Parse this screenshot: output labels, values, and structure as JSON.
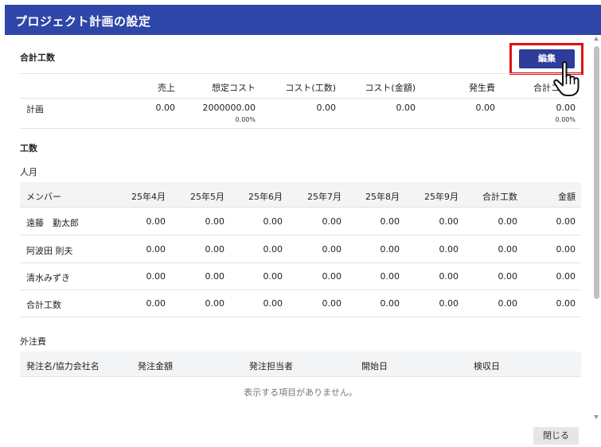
{
  "dialog": {
    "title": "プロジェクト計画の設定"
  },
  "total_effort": {
    "section_title": "合計工数",
    "edit_label": "編集",
    "columns": [
      "売上",
      "想定コスト",
      "コスト(工数)",
      "コスト(金額)",
      "発生費",
      "合計コ"
    ],
    "row_label": "計画",
    "values": [
      "0.00",
      "2000000.00",
      "0.00",
      "0.00",
      "0.00",
      "0.00"
    ],
    "sub_values": [
      "0.00%",
      "0.00%"
    ]
  },
  "effort": {
    "section_title": "工数",
    "person_month": {
      "title": "人月",
      "columns": [
        "メンバー",
        "25年4月",
        "25年5月",
        "25年6月",
        "25年7月",
        "25年8月",
        "25年9月",
        "合計工数",
        "金額"
      ],
      "rows": [
        {
          "member": "遠藤　勤太郎",
          "values": [
            "0.00",
            "0.00",
            "0.00",
            "0.00",
            "0.00",
            "0.00",
            "0.00",
            "0.00"
          ]
        },
        {
          "member": "阿波田 則夫",
          "values": [
            "0.00",
            "0.00",
            "0.00",
            "0.00",
            "0.00",
            "0.00",
            "0.00",
            "0.00"
          ]
        },
        {
          "member": "清水みずき",
          "values": [
            "0.00",
            "0.00",
            "0.00",
            "0.00",
            "0.00",
            "0.00",
            "0.00",
            "0.00"
          ]
        },
        {
          "member": "合計工数",
          "values": [
            "0.00",
            "0.00",
            "0.00",
            "0.00",
            "0.00",
            "0.00",
            "0.00",
            "0.00"
          ]
        }
      ]
    }
  },
  "outsourcing": {
    "title": "外注費",
    "columns": [
      "発注名/協力会社名",
      "発注金額",
      "発注担当者",
      "開始日",
      "検収日"
    ],
    "empty_message": "表示する項目がありません。"
  },
  "footer": {
    "close_label": "閉じる"
  },
  "icons": {
    "pointer": "hand-pointer-icon",
    "scroll_up": "arrow-up-icon",
    "scroll_down": "arrow-down-icon"
  },
  "colors": {
    "title_bar": "#2e46a8",
    "edit_button": "#2e3d9a",
    "highlight": "#e01010",
    "header_band": "#f3f4f6"
  }
}
